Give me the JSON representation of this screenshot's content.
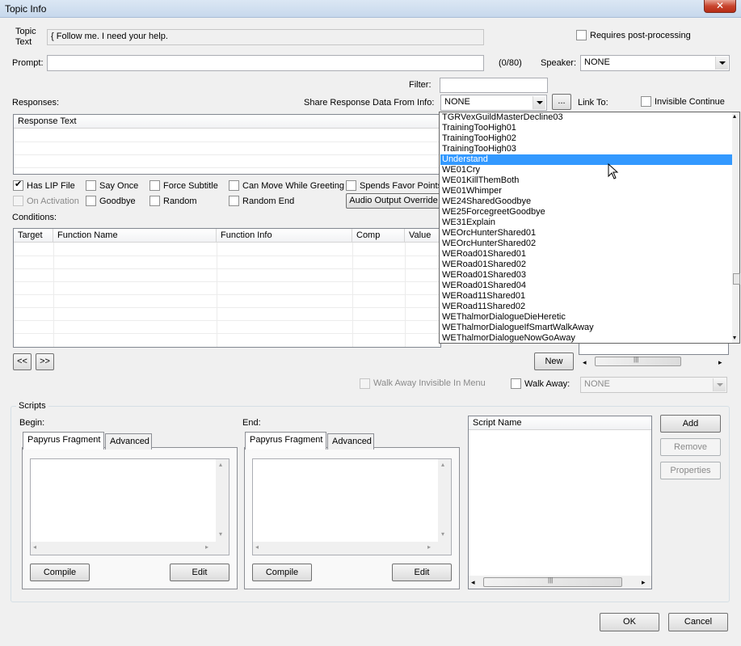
{
  "window": {
    "title": "Topic Info",
    "close_label": "✕"
  },
  "topic": {
    "label_line1": "Topic",
    "label_line2": "Text",
    "value": "{ Follow me. I need your help."
  },
  "requires_post_processing": {
    "label": "Requires post-processing",
    "checked": false
  },
  "prompt": {
    "label": "Prompt:",
    "value": "",
    "counter": "(0/80)"
  },
  "speaker": {
    "label": "Speaker:",
    "value": "NONE"
  },
  "filter": {
    "label": "Filter:",
    "value": ""
  },
  "responses": {
    "label": "Responses:",
    "column": "Response Text"
  },
  "share": {
    "label": "Share Response Data From Info:",
    "value": "NONE",
    "browse_label": "..."
  },
  "link_to": {
    "label": "Link To:"
  },
  "invisible_continue": {
    "label": "Invisible Continue",
    "checked": false
  },
  "options": {
    "has_lip_file": "Has LIP File",
    "say_once": "Say Once",
    "force_subtitle": "Force Subtitle",
    "can_move": "Can Move While Greeting",
    "spends_favor": "Spends Favor Points",
    "on_activation": "On Activation",
    "goodbye": "Goodbye",
    "random": "Random",
    "random_end": "Random End",
    "audio_override": "Audio Output Override"
  },
  "conditions": {
    "label": "Conditions:",
    "columns": [
      "Target",
      "Function Name",
      "Function Info",
      "Comp",
      "Value"
    ],
    "prev_label": "<<",
    "next_label": ">>",
    "new_label": "New"
  },
  "walk_away": {
    "invisible_label": "Walk Away Invisible In Menu",
    "label": "Walk Away:",
    "value": "NONE"
  },
  "dropdown_items": [
    "TGRVexGuildMasterDecline03",
    "TrainingTooHigh01",
    "TrainingTooHigh02",
    "TrainingTooHigh03",
    "Understand",
    "WE01Cry",
    "WE01KillThemBoth",
    "WE01Whimper",
    "WE24SharedGoodbye",
    "WE25ForcegreetGoodbye",
    "WE31Explain",
    "WEOrcHunterShared01",
    "WEOrcHunterShared02",
    "WERoad01Shared01",
    "WERoad01Shared02",
    "WERoad01Shared03",
    "WERoad01Shared04",
    "WERoad11Shared01",
    "WERoad11Shared02",
    "WEThalmorDialogueDieHeretic",
    "WEThalmorDialogueIfSmartWalkAway",
    "WEThalmorDialogueNowGoAway"
  ],
  "dropdown_selected": "Understand",
  "scripts": {
    "group_label": "Scripts",
    "begin_label": "Begin:",
    "end_label": "End:",
    "tab_papyrus": "Papyrus Fragment",
    "tab_advanced": "Advanced",
    "compile_label": "Compile",
    "edit_label": "Edit",
    "script_name_column": "Script Name",
    "add_label": "Add",
    "remove_label": "Remove",
    "properties_label": "Properties"
  },
  "footer": {
    "ok_label": "OK",
    "cancel_label": "Cancel"
  }
}
